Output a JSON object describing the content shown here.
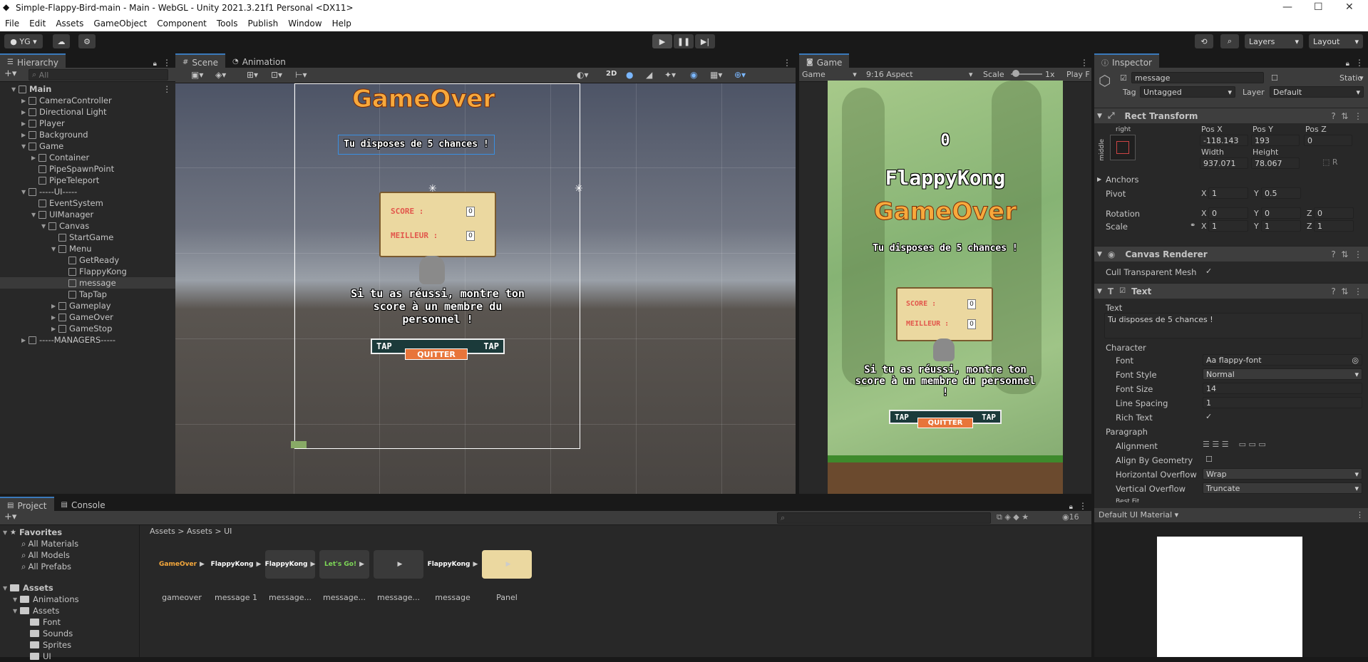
{
  "window": {
    "title": "Simple-Flappy-Bird-main - Main - WebGL - Unity 2021.3.21f1 Personal <DX11>"
  },
  "menu": [
    "File",
    "Edit",
    "Assets",
    "GameObject",
    "Component",
    "Tools",
    "Publish",
    "Window",
    "Help"
  ],
  "toolbar": {
    "account": "YG",
    "layers": "Layers",
    "layout": "Layout"
  },
  "hierarchy": {
    "tab": "Hierarchy",
    "search_placeholder": "All",
    "items": [
      {
        "label": "Main",
        "depth": 0,
        "exp": "▼",
        "type": "scene"
      },
      {
        "label": "CameraController",
        "depth": 1,
        "exp": "▶"
      },
      {
        "label": "Directional Light",
        "depth": 1,
        "exp": "▶"
      },
      {
        "label": "Player",
        "depth": 1,
        "exp": "▶"
      },
      {
        "label": "Background",
        "depth": 1,
        "exp": "▶"
      },
      {
        "label": "Game",
        "depth": 1,
        "exp": "▼"
      },
      {
        "label": "Container",
        "depth": 2,
        "exp": "▶"
      },
      {
        "label": "PipeSpawnPoint",
        "depth": 2,
        "exp": ""
      },
      {
        "label": "PipeTeleport",
        "depth": 2,
        "exp": ""
      },
      {
        "label": "-----UI-----",
        "depth": 1,
        "exp": "▼"
      },
      {
        "label": "EventSystem",
        "depth": 2,
        "exp": ""
      },
      {
        "label": "UIManager",
        "depth": 2,
        "exp": "▼"
      },
      {
        "label": "Canvas",
        "depth": 3,
        "exp": "▼"
      },
      {
        "label": "StartGame",
        "depth": 4,
        "exp": ""
      },
      {
        "label": "Menu",
        "depth": 4,
        "exp": "▼"
      },
      {
        "label": "GetReady",
        "depth": 5,
        "exp": ""
      },
      {
        "label": "FlappyKong",
        "depth": 5,
        "exp": ""
      },
      {
        "label": "message",
        "depth": 5,
        "exp": "",
        "selected": true
      },
      {
        "label": "TapTap",
        "depth": 5,
        "exp": ""
      },
      {
        "label": "Gameplay",
        "depth": 4,
        "exp": "▶"
      },
      {
        "label": "GameOver",
        "depth": 4,
        "exp": "▶"
      },
      {
        "label": "GameStop",
        "depth": 4,
        "exp": "▶"
      },
      {
        "label": "-----MANAGERS-----",
        "depth": 1,
        "exp": "▶"
      }
    ]
  },
  "scene": {
    "tabs": [
      "Scene",
      "Animation"
    ],
    "mode_2d": "2D",
    "game_over": "GameOver",
    "chances": "Tu disposes de 5 chances !",
    "score_label": "SCORE :",
    "best_label": "MEILLEUR :",
    "score_val": "0",
    "best_val": "0",
    "message": "Si tu as réussi, montre ton score à un membre du personnel !",
    "tap_left": "TAP",
    "tap_right": "TAP",
    "quit": "QUITTER"
  },
  "game": {
    "tab": "Game",
    "display": "Game",
    "aspect": "9:16 Aspect",
    "scale_label": "Scale",
    "scale_val": "1x",
    "play_label": "Play F",
    "counter": "0",
    "title": "FlappyKong",
    "game_over": "GameOver",
    "chances": "Tu disposes de 5 chances !",
    "score_label": "SCORE :",
    "best_label": "MEILLEUR :",
    "score_val": "0",
    "best_val": "0",
    "message": "Si tu as réussi, montre ton score à un membre du personnel !",
    "tap_left": "TAP",
    "tap_right": "TAP",
    "quit": "QUITTER"
  },
  "inspector": {
    "tab": "Inspector",
    "object_name": "message",
    "static_label": "Static",
    "tag_label": "Tag",
    "tag_val": "Untagged",
    "layer_label": "Layer",
    "layer_val": "Default",
    "rect": {
      "header": "Rect Transform",
      "anchor_h": "right",
      "anchor_v": "middle",
      "posx_label": "Pos X",
      "posy_label": "Pos Y",
      "posz_label": "Pos Z",
      "posx": "-118.143",
      "posy": "193",
      "posz": "0",
      "width_label": "Width",
      "height_label": "Height",
      "width": "937.071",
      "height": "78.067",
      "anchors": "Anchors",
      "pivot_label": "Pivot",
      "pivot_x": "1",
      "pivot_y": "0.5",
      "rotation_label": "Rotation",
      "rot_x": "0",
      "rot_y": "0",
      "rot_z": "0",
      "scale_label": "Scale",
      "scale_x": "1",
      "scale_y": "1",
      "scale_z": "1"
    },
    "canvas_renderer": {
      "header": "Canvas Renderer",
      "cull_label": "Cull Transparent Mesh"
    },
    "text": {
      "header": "Text",
      "text_label": "Text",
      "text_val": "Tu disposes de 5 chances !",
      "character": "Character",
      "font_label": "Font",
      "font_val": "flappy-font",
      "style_label": "Font Style",
      "style_val": "Normal",
      "size_label": "Font Size",
      "size_val": "14",
      "spacing_label": "Line Spacing",
      "spacing_val": "1",
      "rich_label": "Rich Text",
      "paragraph": "Paragraph",
      "align_label": "Alignment",
      "geom_label": "Align By Geometry",
      "hover_label": "Horizontal Overflow",
      "hover_val": "Wrap",
      "vover_label": "Vertical Overflow",
      "vover_val": "Truncate",
      "bestfit_label": "Best Fit"
    },
    "material": "Default UI Material"
  },
  "project": {
    "tabs": [
      "Project",
      "Console"
    ],
    "breadcrumb": [
      "Assets",
      "Assets",
      "UI"
    ],
    "badge": "16",
    "favorites": {
      "label": "Favorites",
      "items": [
        "All Materials",
        "All Models",
        "All Prefabs"
      ]
    },
    "tree": [
      {
        "label": "Assets",
        "depth": 0
      },
      {
        "label": "Animations",
        "depth": 1
      },
      {
        "label": "Assets",
        "depth": 1
      },
      {
        "label": "Font",
        "depth": 2
      },
      {
        "label": "Sounds",
        "depth": 2
      },
      {
        "label": "Sprites",
        "depth": 2
      },
      {
        "label": "UI",
        "depth": 2
      }
    ],
    "assets": [
      {
        "label": "gameover",
        "thumb": "GameOver"
      },
      {
        "label": "message 1",
        "thumb": "FlappyKong"
      },
      {
        "label": "message...",
        "thumb": "FlappyKong"
      },
      {
        "label": "message...",
        "thumb": "Let's Go!"
      },
      {
        "label": "message...",
        "thumb": ""
      },
      {
        "label": "message",
        "thumb": "FlappyKong"
      },
      {
        "label": "Panel",
        "thumb": ""
      }
    ]
  },
  "colors": {
    "accent": "#3a79bb",
    "selection": "#2c5d87",
    "orange": "#f7a93c"
  }
}
